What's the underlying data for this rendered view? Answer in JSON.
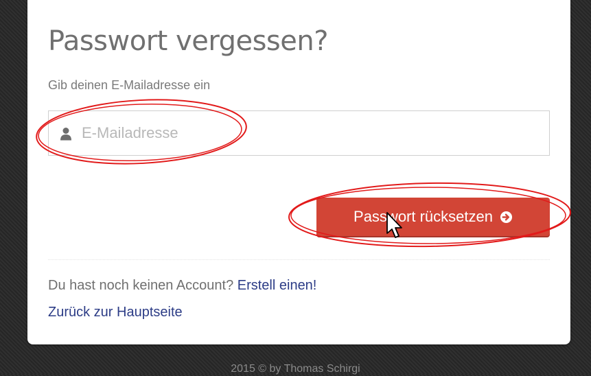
{
  "title": "Passwort vergessen?",
  "subtitle": "Gib deinen E-Mailadresse ein",
  "email": {
    "placeholder": "E-Mailadresse",
    "value": "",
    "icon": "user-icon"
  },
  "submit": {
    "label": "Passwort rücksetzen",
    "icon": "arrow-circle-right-icon"
  },
  "account": {
    "prompt": "Du hast noch keinen Account?",
    "create_label": "Erstell einen!"
  },
  "back_label": "Zurück zur Hauptseite",
  "footer": "2015 © by Thomas Schirgi",
  "colors": {
    "button": "#d24536",
    "link": "#2c3c86",
    "annotation": "#e21a1a"
  }
}
